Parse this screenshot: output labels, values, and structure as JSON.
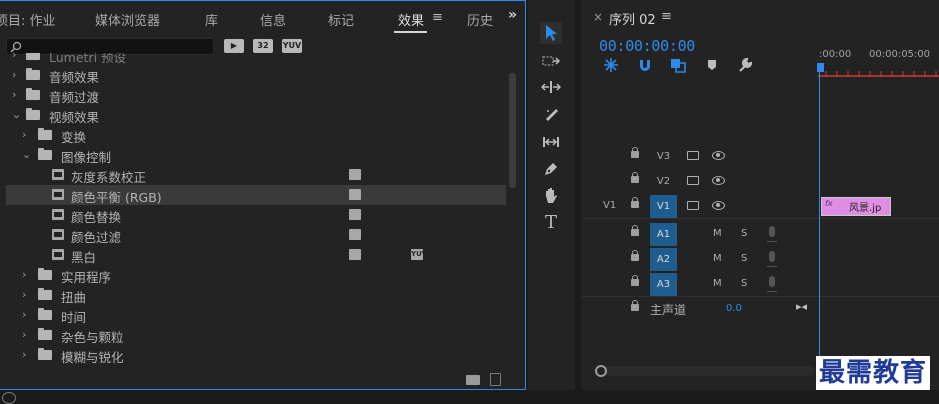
{
  "effects_panel": {
    "tabs": [
      {
        "label": "项目: 作业"
      },
      {
        "label": "媒体浏览器"
      },
      {
        "label": "库"
      },
      {
        "label": "信息"
      },
      {
        "label": "标记"
      },
      {
        "label": "效果"
      },
      {
        "label": "历史"
      }
    ],
    "active_tab": "效果",
    "menu_glyph": "≡",
    "overflow_glyph": "»",
    "search": {
      "value": "",
      "placeholder": ""
    },
    "filter_buttons": [
      "",
      "32",
      "YUV"
    ],
    "tree": [
      {
        "label": "Lumetri 预设",
        "level": 0,
        "chevron": "›",
        "icon": "folder",
        "dim": true
      },
      {
        "label": "音频效果",
        "level": 0,
        "chevron": "›",
        "icon": "folder"
      },
      {
        "label": "音频过渡",
        "level": 0,
        "chevron": "›",
        "icon": "folder"
      },
      {
        "label": "视频效果",
        "level": 0,
        "chevron": "⌄",
        "icon": "folder"
      },
      {
        "label": "变换",
        "level": 1,
        "chevron": "›",
        "icon": "folder"
      },
      {
        "label": "图像控制",
        "level": 1,
        "chevron": "⌄",
        "icon": "folder"
      },
      {
        "label": "灰度系数校正",
        "level": 2,
        "icon": "effect",
        "badges": [
          ""
        ]
      },
      {
        "label": "颜色平衡 (RGB)",
        "level": 2,
        "icon": "effect",
        "badges": [
          ""
        ],
        "selected": true
      },
      {
        "label": "颜色替换",
        "level": 2,
        "icon": "effect",
        "badges": [
          ""
        ]
      },
      {
        "label": "颜色过滤",
        "level": 2,
        "icon": "effect",
        "badges": [
          ""
        ]
      },
      {
        "label": "黑白",
        "level": 2,
        "icon": "effect",
        "badges": [
          "",
          "YUV"
        ]
      },
      {
        "label": "实用程序",
        "level": 1,
        "chevron": "›",
        "icon": "folder"
      },
      {
        "label": "扭曲",
        "level": 1,
        "chevron": "›",
        "icon": "folder"
      },
      {
        "label": "时间",
        "level": 1,
        "chevron": "›",
        "icon": "folder"
      },
      {
        "label": "杂色与颗粒",
        "level": 1,
        "chevron": "›",
        "icon": "folder"
      },
      {
        "label": "模糊与锐化",
        "level": 1,
        "chevron": "›",
        "icon": "folder"
      }
    ]
  },
  "tools": [
    "selection-tool",
    "track-select-tool",
    "ripple-edit-tool",
    "razor-tool",
    "slip-tool",
    "pen-tool",
    "hand-tool",
    "type-tool"
  ],
  "timeline": {
    "close_glyph": "×",
    "title": "序列 02",
    "menu_glyph": "≡",
    "timecode": "00:00:00:00",
    "ruler_labels": [
      ":00:00",
      "00:00:05:00"
    ],
    "tracks": [
      {
        "name": "V3",
        "kind": "video",
        "source": "",
        "on": false
      },
      {
        "name": "V2",
        "kind": "video",
        "source": "",
        "on": false
      },
      {
        "name": "V1",
        "kind": "video",
        "source": "V1",
        "on": true
      },
      {
        "name": "A1",
        "kind": "audio",
        "source": "",
        "on": true
      },
      {
        "name": "A2",
        "kind": "audio",
        "source": "",
        "on": true
      },
      {
        "name": "A3",
        "kind": "audio",
        "source": "",
        "on": true
      }
    ],
    "mute_label": "M",
    "solo_label": "S",
    "master": {
      "label": "主声道",
      "value": "0.0"
    },
    "clip": {
      "fx": "fx",
      "label": "风景.jp"
    }
  },
  "watermark": "最需教育",
  "colors": {
    "accent": "#2d8ceb",
    "clip": "#de8fe3",
    "track_on": "#1f5d8f"
  }
}
